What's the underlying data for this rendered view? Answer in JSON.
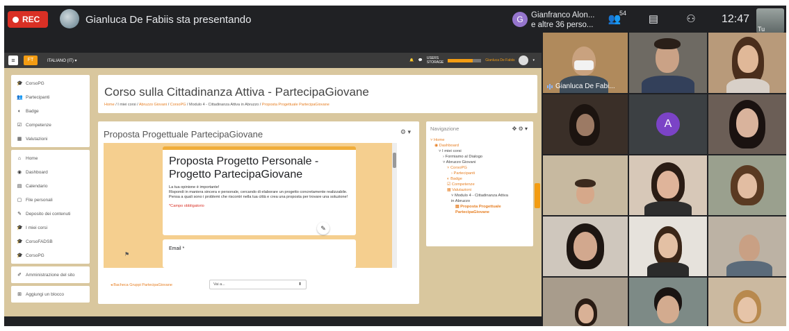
{
  "meet": {
    "rec_label": "REC",
    "presenting_text": "Gianluca De Fabiis sta presentando",
    "joiner_initial": "G",
    "joiner_line1": "Gianfranco Alon...",
    "joiner_line2": "e altre 36 perso...",
    "people_count": "54",
    "clock": "12:47",
    "self_label": "Tu",
    "accent": "#d93025"
  },
  "moodle": {
    "lang": "ITALIANO (IT) ▾",
    "logo_text": "FT",
    "users_label": "USERS",
    "storage_label": "STORAGE",
    "storage_fraction": 0.75,
    "user_name": "Gianluca De Fabiis",
    "sidebar_group1": [
      {
        "icon": "graduation-cap-icon",
        "glyph": "🎓",
        "label": "CorsoPG"
      },
      {
        "icon": "users-icon",
        "glyph": "👥",
        "label": "Partecipanti"
      },
      {
        "icon": "badge-icon",
        "glyph": "◐",
        "label": "Badge"
      },
      {
        "icon": "check-square-icon",
        "glyph": "☑",
        "label": "Competenze"
      },
      {
        "icon": "table-icon",
        "glyph": "▦",
        "label": "Valutazioni"
      }
    ],
    "sidebar_group2": [
      {
        "icon": "home-icon",
        "glyph": "⌂",
        "label": "Home"
      },
      {
        "icon": "dashboard-icon",
        "glyph": "◉",
        "label": "Dashboard"
      },
      {
        "icon": "calendar-icon",
        "glyph": "▤",
        "label": "Calendario"
      },
      {
        "icon": "file-icon",
        "glyph": "▢",
        "label": "File personali"
      },
      {
        "icon": "pencil-icon",
        "glyph": "✎",
        "label": "Deposito dei contenuti"
      },
      {
        "icon": "graduation-cap-icon",
        "glyph": "🎓",
        "label": "I miei corsi"
      },
      {
        "icon": "graduation-cap-icon",
        "glyph": "🎓",
        "label": "CorsoFADSB"
      },
      {
        "icon": "graduation-cap-icon",
        "glyph": "🎓",
        "label": "CorsoPG"
      }
    ],
    "sidebar_group3": [
      {
        "icon": "wrench-icon",
        "glyph": "✐",
        "label": "Amministrazione del sito"
      }
    ],
    "sidebar_group4": [
      {
        "icon": "plus-square-icon",
        "glyph": "⊞",
        "label": "Aggiungi un blocco"
      }
    ],
    "course_title": "Corso sulla Cittadinanza Attiva - PartecipaGiovane",
    "breadcrumb": {
      "home": "Home",
      "sep": " / ",
      "c1": "I miei corsi",
      "c2": "Abruzzo Giovani",
      "c3": "CorsoPG",
      "c4": "Modulo 4 - Cittadinanza Attiva in Abruzzo",
      "c5": "Proposta Progettuale PartecipaGiovane"
    },
    "content_title": "Proposta Progettuale PartecipaGiovane",
    "form": {
      "title": "Proposta Progetto Personale - Progetto PartecipaGiovane",
      "desc_line1": "La tua opinione è importante!",
      "desc_line2": "Rispondi in maniera sincera e personale, cercando di elaborare un progetto concretamente realizzabile.",
      "desc_line3": "Pensa a quali sono i problemi che riscontri nella tua città e crea una proposta per trovare una soluzione!",
      "required_note": "*Campo obbligatorio",
      "email_label": "Email *"
    },
    "footer_link": "◂ Bacheca Gruppi PartecipaGiovane",
    "jump_select": "Vai a...",
    "nav": {
      "title": "Navigazione",
      "items": [
        {
          "text": "˅ Home",
          "style": "orange",
          "indent": 0
        },
        {
          "text": "◉ Dashboard",
          "style": "orange",
          "indent": 1
        },
        {
          "text": "˅ I miei corsi",
          "style": "dark",
          "indent": 2
        },
        {
          "text": "› Formiamo al Dialogo",
          "style": "dark",
          "indent": 3
        },
        {
          "text": "˅ Abruzzo Giovani",
          "style": "dark",
          "indent": 3
        },
        {
          "text": "˅ CorsoPG",
          "style": "orange",
          "indent": 4
        },
        {
          "text": "› Partecipanti",
          "style": "orange",
          "indent": 5
        },
        {
          "text": "◐ Badge",
          "style": "orange",
          "indent": 4
        },
        {
          "text": "☑ Competenze",
          "style": "orange",
          "indent": 4
        },
        {
          "text": "▦ Valutazioni",
          "style": "orange",
          "indent": 4
        },
        {
          "text": "˅ Modulo 4 - Cittadinanza Attiva",
          "style": "dark",
          "indent": 5
        },
        {
          "text": "in Abruzzo",
          "style": "dark",
          "indent": 5
        },
        {
          "text": "▤ Proposta Progettuale",
          "style": "bold",
          "indent": 6
        },
        {
          "text": "PartecipaGiovane",
          "style": "bold",
          "indent": 6
        }
      ]
    }
  },
  "participants": {
    "pinned_name": "Gianluca De Fabi...",
    "avatar_initial": "A"
  }
}
